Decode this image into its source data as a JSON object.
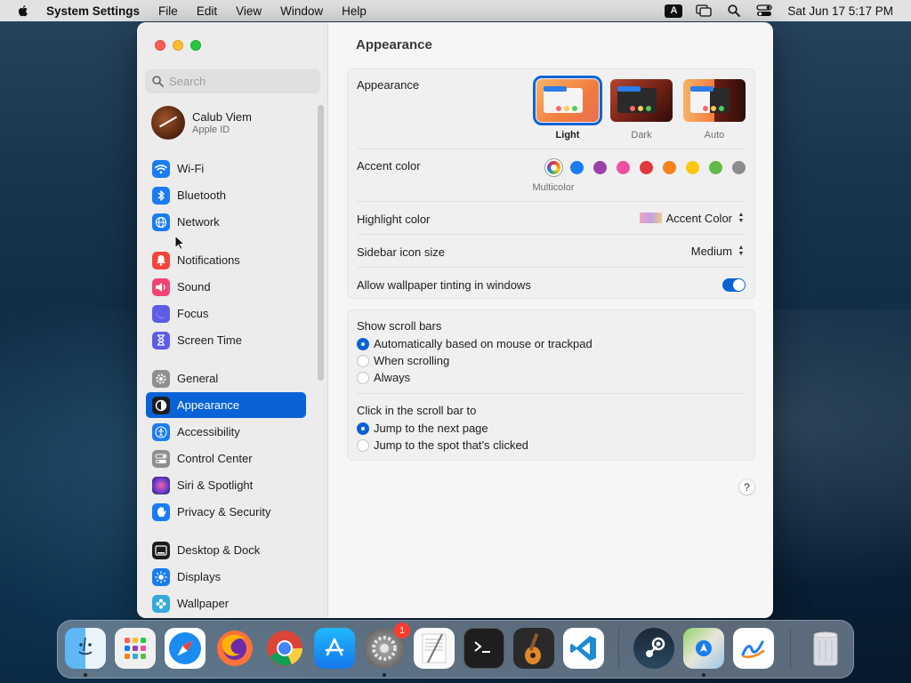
{
  "menubar": {
    "app_name": "System Settings",
    "menus": [
      "File",
      "Edit",
      "View",
      "Window",
      "Help"
    ],
    "input_indicator": "A",
    "clock": "Sat Jun 17  5:17 PM"
  },
  "sidebar": {
    "search_placeholder": "Search",
    "user": {
      "name": "Calub Viem",
      "subtitle": "Apple ID"
    },
    "items": [
      {
        "label": "Wi-Fi",
        "icon": "wifi-icon",
        "color": "#1a7cf2"
      },
      {
        "label": "Bluetooth",
        "icon": "bluetooth-icon",
        "color": "#1a7cf2"
      },
      {
        "label": "Network",
        "icon": "globe-icon",
        "color": "#1a7cf2"
      },
      {
        "label": "Notifications",
        "icon": "bell-icon",
        "color": "#f2463d"
      },
      {
        "label": "Sound",
        "icon": "speaker-icon",
        "color": "#f24472"
      },
      {
        "label": "Focus",
        "icon": "moon-icon",
        "color": "#5e5ce6"
      },
      {
        "label": "Screen Time",
        "icon": "hourglass-icon",
        "color": "#5e5ce6"
      },
      {
        "label": "General",
        "icon": "gear-icon",
        "color": "#8e8e93"
      },
      {
        "label": "Appearance",
        "icon": "appearance-icon",
        "color": "#1d1d1f",
        "active": true
      },
      {
        "label": "Accessibility",
        "icon": "accessibility-icon",
        "color": "#1a7cf2"
      },
      {
        "label": "Control Center",
        "icon": "toggles-icon",
        "color": "#8e8e93"
      },
      {
        "label": "Siri & Spotlight",
        "icon": "siri-icon",
        "color": "#6a3fd1"
      },
      {
        "label": "Privacy & Security",
        "icon": "hand-icon",
        "color": "#1a7cf2"
      },
      {
        "label": "Desktop & Dock",
        "icon": "dock-icon",
        "color": "#1d1d1f"
      },
      {
        "label": "Displays",
        "icon": "sun-icon",
        "color": "#1a7cf2"
      },
      {
        "label": "Wallpaper",
        "icon": "flower-icon",
        "color": "#34aadc"
      }
    ]
  },
  "main": {
    "title": "Appearance",
    "appearance": {
      "label": "Appearance",
      "options": [
        {
          "label": "Light",
          "selected": true
        },
        {
          "label": "Dark",
          "selected": false
        },
        {
          "label": "Auto",
          "selected": false
        }
      ]
    },
    "accent": {
      "label": "Accent color",
      "selected_label": "Multicolor",
      "colors": [
        "multicolor",
        "#1a7cf2",
        "#9b40a9",
        "#ef4f9f",
        "#e0383e",
        "#f7821b",
        "#fcc70d",
        "#62ba46",
        "#8c8c8c"
      ]
    },
    "highlight": {
      "label": "Highlight color",
      "value": "Accent Color"
    },
    "sidebar_icon_size": {
      "label": "Sidebar icon size",
      "value": "Medium"
    },
    "wallpaper_tinting": {
      "label": "Allow wallpaper tinting in windows",
      "enabled": true
    },
    "scroll_bars": {
      "label": "Show scroll bars",
      "options": [
        {
          "label": "Automatically based on mouse or trackpad",
          "selected": true
        },
        {
          "label": "When scrolling",
          "selected": false
        },
        {
          "label": "Always",
          "selected": false
        }
      ]
    },
    "click_scroll": {
      "label": "Click in the scroll bar to",
      "options": [
        {
          "label": "Jump to the next page",
          "selected": true
        },
        {
          "label": "Jump to the spot that’s clicked",
          "selected": false
        }
      ]
    },
    "help": "?"
  },
  "dock": {
    "apps": [
      {
        "name": "Finder",
        "icon": "finder-icon",
        "running": true
      },
      {
        "name": "Launchpad",
        "icon": "launchpad-icon",
        "running": false
      },
      {
        "name": "Safari",
        "icon": "safari-icon",
        "running": false
      },
      {
        "name": "Firefox",
        "icon": "firefox-icon",
        "running": false
      },
      {
        "name": "Chrome",
        "icon": "chrome-icon",
        "running": false
      },
      {
        "name": "App Store",
        "icon": "app-store-icon",
        "running": false
      },
      {
        "name": "System Settings",
        "icon": "system-settings-icon",
        "running": true,
        "badge": "1"
      },
      {
        "name": "TextEdit",
        "icon": "textedit-icon",
        "running": false
      },
      {
        "name": "Terminal",
        "icon": "terminal-icon",
        "running": false
      },
      {
        "name": "GarageBand",
        "icon": "garageband-icon",
        "running": false
      },
      {
        "name": "VS Code",
        "icon": "vscode-icon",
        "running": false
      },
      {
        "name": "Steam",
        "icon": "steam-icon",
        "running": false
      },
      {
        "name": "Maps",
        "icon": "maps-icon",
        "running": true
      },
      {
        "name": "Freeform",
        "icon": "freeform-icon",
        "running": false
      },
      {
        "name": "Trash",
        "icon": "trash-icon",
        "running": false
      }
    ]
  }
}
